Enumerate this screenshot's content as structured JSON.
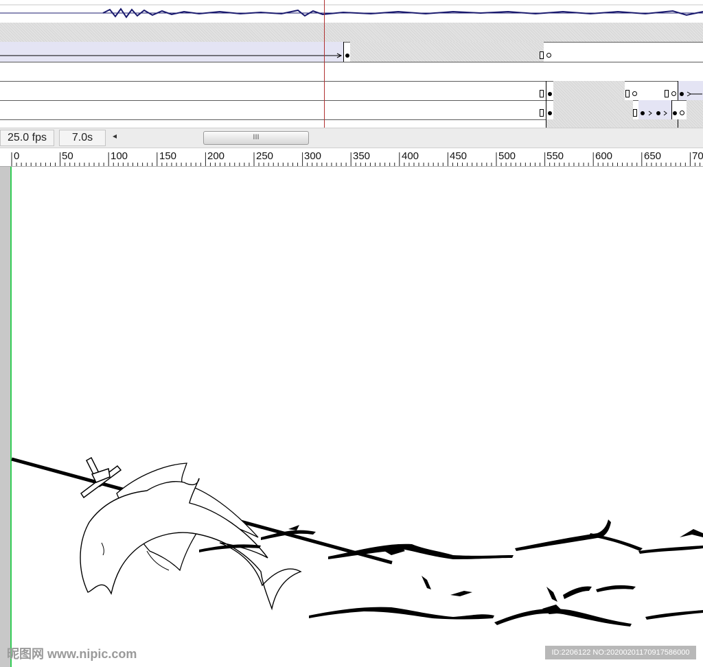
{
  "timeline": {
    "fps_label": "25.0 fps",
    "duration_label": "7.0s",
    "scroll_left_arrow": "◂",
    "scroll_thumb_grip": "III"
  },
  "ruler": {
    "labels": [
      "0",
      "50",
      "100",
      "150",
      "200",
      "250",
      "300",
      "350",
      "400",
      "450",
      "500",
      "550",
      "600",
      "650",
      "70"
    ]
  },
  "watermarks": {
    "left": "昵图网 www.nipic.com",
    "right": "ID:2206122 NO:20200201170917586000"
  },
  "colors": {
    "playhead": "#b03030",
    "waveform": "#1a1a6e",
    "stage_edge": "#33cc55",
    "tween_fill": "#e4e4f4"
  },
  "icons": {
    "scroll_left": "left-arrow-icon",
    "keyframe_filled": "filled-keyframe-icon",
    "keyframe_empty": "empty-keyframe-icon",
    "keyframe_end": "end-frame-icon"
  }
}
